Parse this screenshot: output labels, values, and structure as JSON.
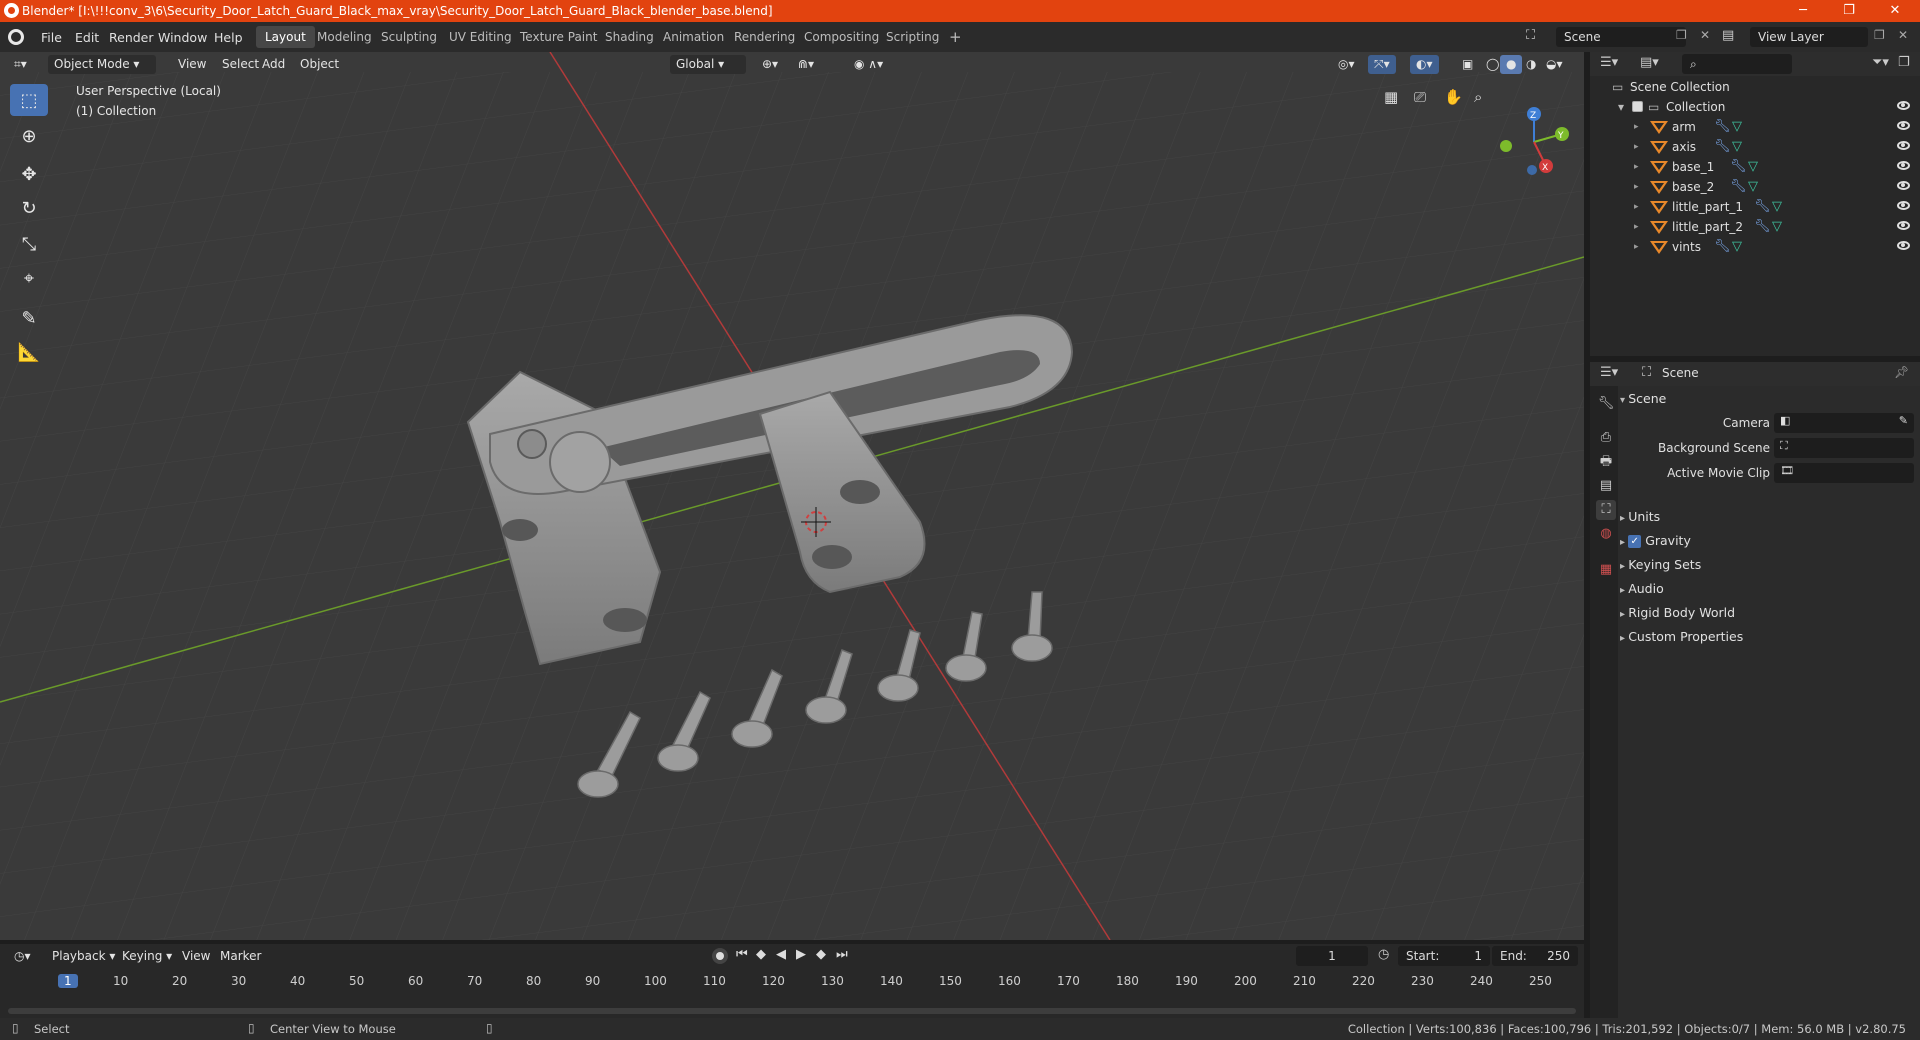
{
  "titlebar": {
    "title": "Blender* [I:\\!!!conv_3\\6\\Security_Door_Latch_Guard_Black_max_vray\\Security_Door_Latch_Guard_Black_blender_base.blend]",
    "min": "─",
    "max": "❐",
    "close": "✕"
  },
  "menu": {
    "file": "File",
    "edit": "Edit",
    "render": "Render",
    "window": "Window",
    "help": "Help"
  },
  "workspaces": [
    "Layout",
    "Modeling",
    "Sculpting",
    "UV Editing",
    "Texture Paint",
    "Shading",
    "Animation",
    "Rendering",
    "Compositing",
    "Scripting"
  ],
  "workspace_add": "+",
  "scene_field": "Scene",
  "view_layer_field": "View Layer",
  "viewport": {
    "mode": "Object Mode",
    "view": "View",
    "select": "Select",
    "add": "Add",
    "object": "Object",
    "orientation": "Global",
    "overlay_line1": "User Perspective (Local)",
    "overlay_line2": "(1) Collection"
  },
  "gizmo": {
    "z": "Z",
    "y": "Y",
    "x": "X"
  },
  "outliner": {
    "scene_collection": "Scene Collection",
    "collection": "Collection",
    "items": [
      "arm",
      "axis",
      "base_1",
      "base_2",
      "little_part_1",
      "little_part_2",
      "vints"
    ]
  },
  "properties": {
    "header": "Scene",
    "section": "Scene",
    "camera_label": "Camera",
    "bg_scene_label": "Background Scene",
    "movie_clip_label": "Active Movie Clip",
    "panels": [
      "Units",
      "Gravity",
      "Keying Sets",
      "Audio",
      "Rigid Body World",
      "Custom Properties"
    ]
  },
  "timeline": {
    "playback": "Playback",
    "keying": "Keying",
    "view": "View",
    "marker": "Marker",
    "current_frame": "1",
    "start_label": "Start:",
    "start_value": "1",
    "end_label": "End:",
    "end_value": "250",
    "ticks": [
      "1",
      "10",
      "20",
      "30",
      "40",
      "50",
      "60",
      "70",
      "80",
      "90",
      "100",
      "110",
      "120",
      "130",
      "140",
      "150",
      "160",
      "170",
      "180",
      "190",
      "200",
      "210",
      "220",
      "230",
      "240",
      "250"
    ]
  },
  "status": {
    "select": "Select",
    "center_view": "Center View to Mouse",
    "info": "Collection | Verts:100,836 | Faces:100,796 | Tris:201,592 | Objects:0/7 | Mem: 56.0 MB | v2.80.75"
  },
  "colors": {
    "title_bar": "#e2430f",
    "accent": "#4772b3",
    "x_axis": "#d23c3c",
    "y_axis": "#7dbb2b",
    "object_orange": "#e8882a"
  }
}
